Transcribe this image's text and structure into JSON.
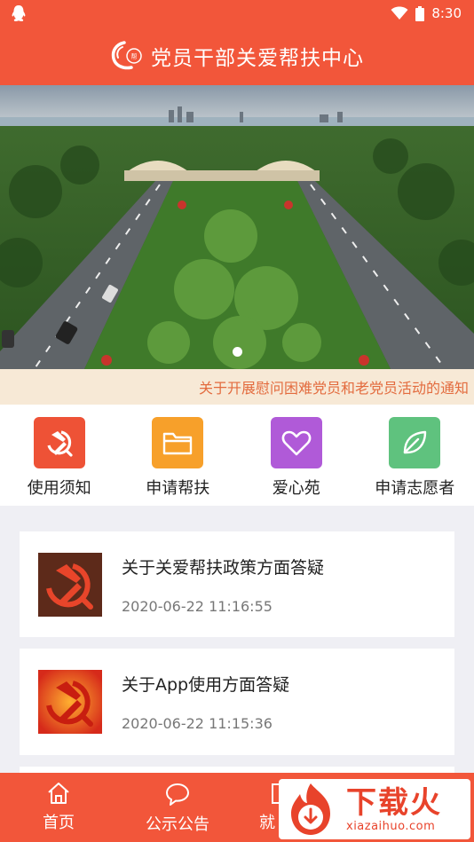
{
  "status_bar": {
    "time": "8:30"
  },
  "header": {
    "title": "党员干部关爱帮扶中心"
  },
  "banner": {
    "slide_count": 1,
    "active_slide": 1
  },
  "notice": {
    "text": "关于开展慰问困难党员和老党员活动的通知"
  },
  "quick_menu": [
    {
      "label": "使用须知",
      "icon": "party-emblem-icon",
      "color": "#ee5236"
    },
    {
      "label": "申请帮扶",
      "icon": "folder-icon",
      "color": "#f7a02a"
    },
    {
      "label": "爱心苑",
      "icon": "heart-icon",
      "color": "#b05ad8"
    },
    {
      "label": "申请志愿者",
      "icon": "leaf-icon",
      "color": "#5fc27e"
    }
  ],
  "news": [
    {
      "title": "关于关爱帮扶政策方面答疑",
      "time": "2020-06-22 11:16:55"
    },
    {
      "title": "关于App使用方面答疑",
      "time": "2020-06-22 11:15:36"
    }
  ],
  "bottom_nav": [
    {
      "label": "首页",
      "icon": "home-icon"
    },
    {
      "label": "公示公告",
      "icon": "chat-bubble-icon"
    },
    {
      "label": "就",
      "icon": "document-icon"
    }
  ],
  "watermark": {
    "big": "下载火",
    "small": "xiazaihuo.com"
  },
  "colors": {
    "primary": "#f2563a",
    "notice_bg": "#f7e9d6",
    "notice_text": "#e36b3e"
  }
}
